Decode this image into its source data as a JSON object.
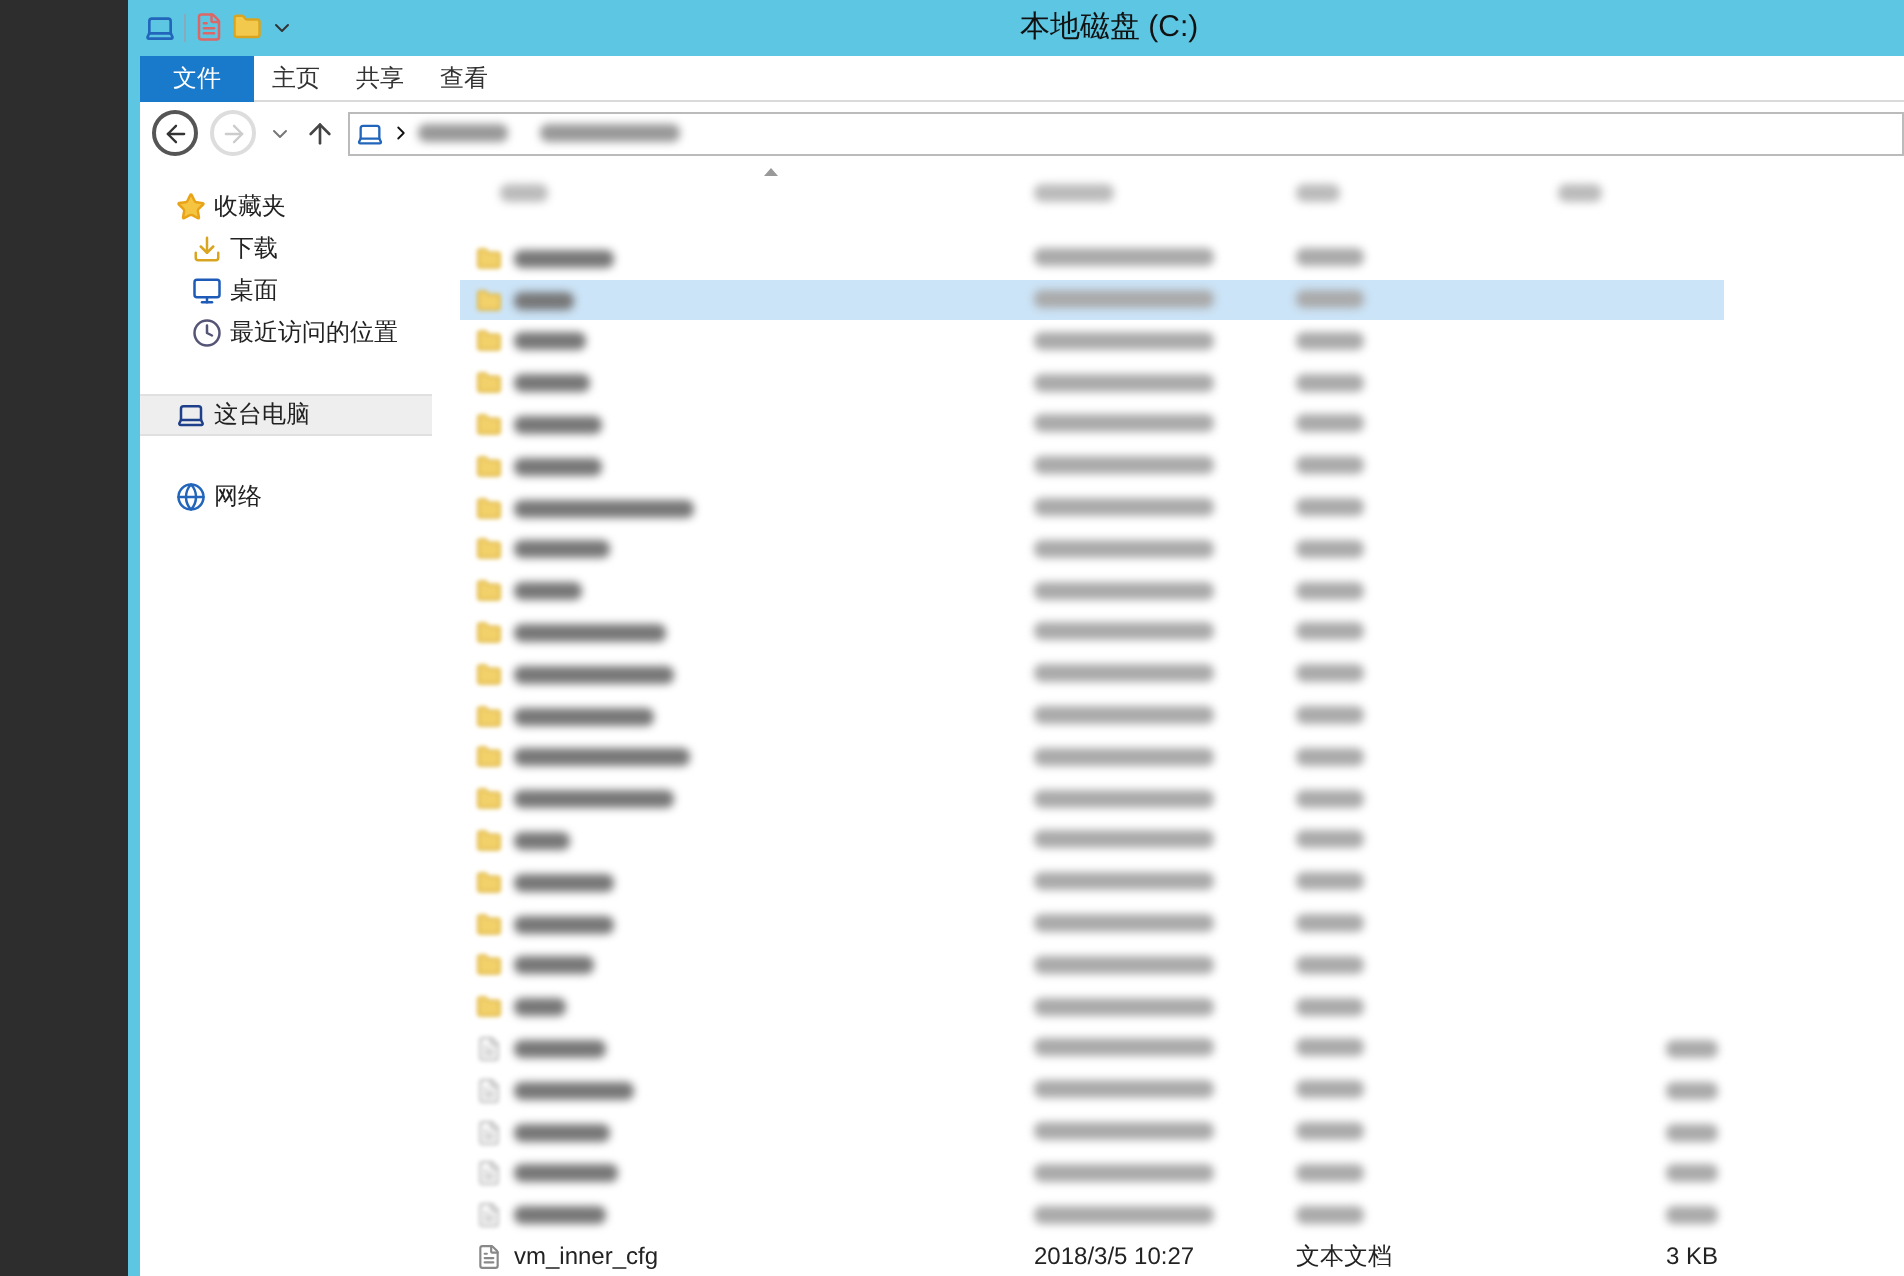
{
  "window": {
    "title": "本地磁盘 (C:)"
  },
  "ribbon_tabs": [
    {
      "label": "文件",
      "selected": true
    },
    {
      "label": "主页",
      "selected": false
    },
    {
      "label": "共享",
      "selected": false
    },
    {
      "label": "查看",
      "selected": false
    }
  ],
  "nav_pane": {
    "groups": [
      {
        "label": "收藏夹",
        "kind": "favorites",
        "selected": false,
        "children": [
          {
            "label": "下载",
            "kind": "downloads"
          },
          {
            "label": "桌面",
            "kind": "desktop"
          },
          {
            "label": "最近访问的位置",
            "kind": "recent"
          }
        ]
      },
      {
        "label": "这台电脑",
        "kind": "computer",
        "selected": true
      },
      {
        "label": "网络",
        "kind": "network",
        "selected": false
      }
    ]
  },
  "rows": [
    {
      "kind": "folder",
      "selected": false
    },
    {
      "kind": "folder",
      "selected": true
    },
    {
      "kind": "folder",
      "selected": false
    },
    {
      "kind": "folder",
      "selected": false
    },
    {
      "kind": "folder",
      "selected": false
    },
    {
      "kind": "folder",
      "selected": false
    },
    {
      "kind": "folder",
      "selected": false
    },
    {
      "kind": "folder",
      "selected": false
    },
    {
      "kind": "folder",
      "selected": false
    },
    {
      "kind": "folder",
      "selected": false
    },
    {
      "kind": "folder",
      "selected": false
    },
    {
      "kind": "folder",
      "selected": false
    },
    {
      "kind": "folder",
      "selected": false
    },
    {
      "kind": "folder",
      "selected": false
    },
    {
      "kind": "folder",
      "selected": false
    },
    {
      "kind": "folder",
      "selected": false
    },
    {
      "kind": "folder",
      "selected": false
    },
    {
      "kind": "folder",
      "selected": false
    },
    {
      "kind": "folder",
      "selected": false
    },
    {
      "kind": "file",
      "selected": false
    },
    {
      "kind": "file",
      "selected": false
    },
    {
      "kind": "file",
      "selected": false
    },
    {
      "kind": "file",
      "selected": false
    },
    {
      "kind": "file",
      "selected": false
    }
  ],
  "last_row": {
    "name": "vm_inner_cfg",
    "modified": "2018/3/5 10:27",
    "type": "文本文档",
    "size": "3 KB"
  }
}
